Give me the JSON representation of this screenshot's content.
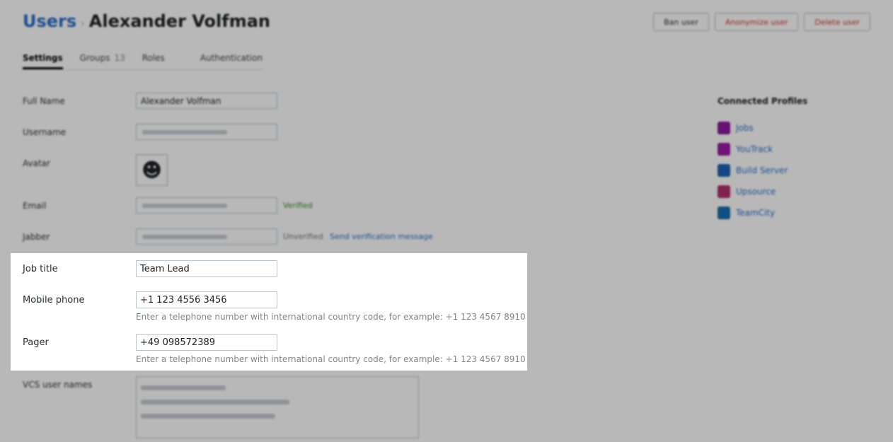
{
  "header": {
    "breadcrumb_root": "Users",
    "user_name": "Alexander Volfman",
    "buttons": {
      "ban": "Ban user",
      "anonymize": "Anonymize user",
      "delete": "Delete user"
    }
  },
  "tabs": [
    {
      "label": "Settings",
      "count": ""
    },
    {
      "label": "Groups",
      "count": "13"
    },
    {
      "label": "Roles",
      "count": ""
    },
    {
      "label": "Authentication",
      "count": ""
    }
  ],
  "form": {
    "full_name_label": "Full Name",
    "full_name_value": "Alexander Volfman",
    "username_label": "Username",
    "avatar_label": "Avatar",
    "email_label": "Email",
    "email_status": "Verified",
    "jabber_label": "Jabber",
    "jabber_status": "Unverified",
    "jabber_link": "Send verification message",
    "vcs_label": "VCS user names"
  },
  "highlight": {
    "job_title_label": "Job title",
    "job_title_value": "Team Lead",
    "mobile_label": "Mobile phone",
    "mobile_value": "+1 123 4556 3456",
    "mobile_hint": "Enter a telephone number with international country code, for example: +1 123 4567 8910",
    "pager_label": "Pager",
    "pager_value": "+49 098572389",
    "pager_hint": "Enter a telephone number with international country code, for example: +1 123 4567 8910"
  },
  "profiles": {
    "title": "Connected Profiles",
    "items": [
      {
        "label": "Jobs",
        "icon": "jobs-icon",
        "color": "#8a1b9c"
      },
      {
        "label": "YouTrack",
        "icon": "youtrack-icon",
        "color": "#9b1ba4"
      },
      {
        "label": "Build Server",
        "icon": "build-server-icon",
        "color": "#1c63b4"
      },
      {
        "label": "Upsource",
        "icon": "upsource-icon",
        "color": "#b0306a"
      },
      {
        "label": "TeamCity",
        "icon": "teamcity-icon",
        "color": "#1b6fb0"
      }
    ]
  }
}
